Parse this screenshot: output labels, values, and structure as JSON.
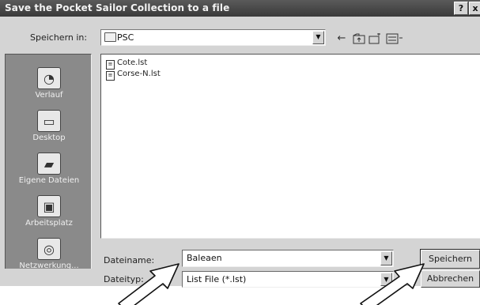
{
  "dialog": {
    "title": "Save the Pocket Sailor Collection to a file",
    "help_btn": "?",
    "close_btn": "x"
  },
  "toolbar": {
    "save_in_label": "Speichern in:",
    "folder": "PSC",
    "icons": [
      "back-arrow-icon",
      "up-folder-icon",
      "new-folder-icon",
      "view-menu-icon"
    ]
  },
  "places": [
    {
      "label": "Verlauf",
      "icon": "history-icon"
    },
    {
      "label": "Desktop",
      "icon": "desktop-icon"
    },
    {
      "label": "Eigene Dateien",
      "icon": "my-documents-icon"
    },
    {
      "label": "Arbeitsplatz",
      "icon": "my-computer-icon"
    },
    {
      "label": "Netzwerkung...",
      "icon": "network-icon"
    }
  ],
  "files": [
    {
      "name": "Cote.lst"
    },
    {
      "name": "Corse-N.lst"
    }
  ],
  "footer": {
    "filename_label": "Dateiname:",
    "filename_value": "Baleaen",
    "filetype_label": "Dateityp:",
    "filetype_value": "List File (*.lst)",
    "save_button": "Speichern",
    "cancel_button": "Abbrechen"
  }
}
